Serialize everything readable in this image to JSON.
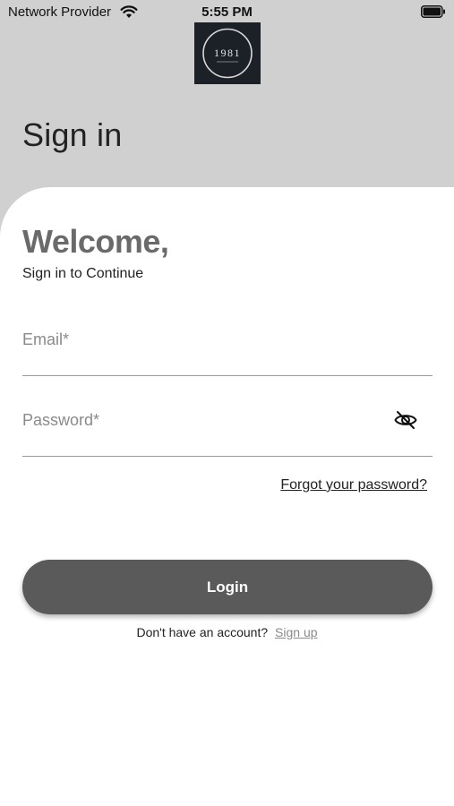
{
  "status_bar": {
    "carrier": "Network Provider",
    "time": "5:55 PM",
    "wifi_icon": "wifi-icon",
    "battery_icon": "battery-icon"
  },
  "logo": {
    "text": "1981",
    "tagline": "",
    "background_color": "#1c2128"
  },
  "header": {
    "title": "Sign in"
  },
  "card": {
    "heading": "Welcome,",
    "subtitle": "Sign in to Continue"
  },
  "form": {
    "email": {
      "value": "",
      "placeholder": "Email*"
    },
    "password": {
      "value": "",
      "placeholder": "Password*",
      "toggle_icon": "eye-slash-icon"
    },
    "forgot_password_label": "Forgot your password?",
    "login_label": "Login"
  },
  "signup": {
    "prompt": "Don't have an account?",
    "link_label": "Sign up"
  },
  "colors": {
    "header_background": "#d0d0d0",
    "card_background": "#ffffff",
    "button_background": "#5a5a5a",
    "heading_color": "#6a6a6a",
    "link_muted": "#8a8a8a"
  }
}
